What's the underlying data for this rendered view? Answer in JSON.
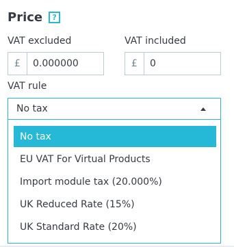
{
  "section": {
    "title": "Price",
    "help_icon_label": "?"
  },
  "vat_excluded": {
    "label": "VAT excluded",
    "currency": "£",
    "value": "0.000000"
  },
  "vat_included": {
    "label": "VAT included",
    "currency": "£",
    "value": "0"
  },
  "vat_rule": {
    "label": "VAT rule",
    "selected": "No tax",
    "options": [
      "No tax",
      "EU VAT For Virtual Products",
      "Import module tax (20.000%)",
      "UK Reduced Rate (15%)",
      "UK Standard Rate (20%)"
    ]
  },
  "colors": {
    "accent": "#25b9d7",
    "border": "#bbcdd2",
    "text": "#363a41"
  }
}
